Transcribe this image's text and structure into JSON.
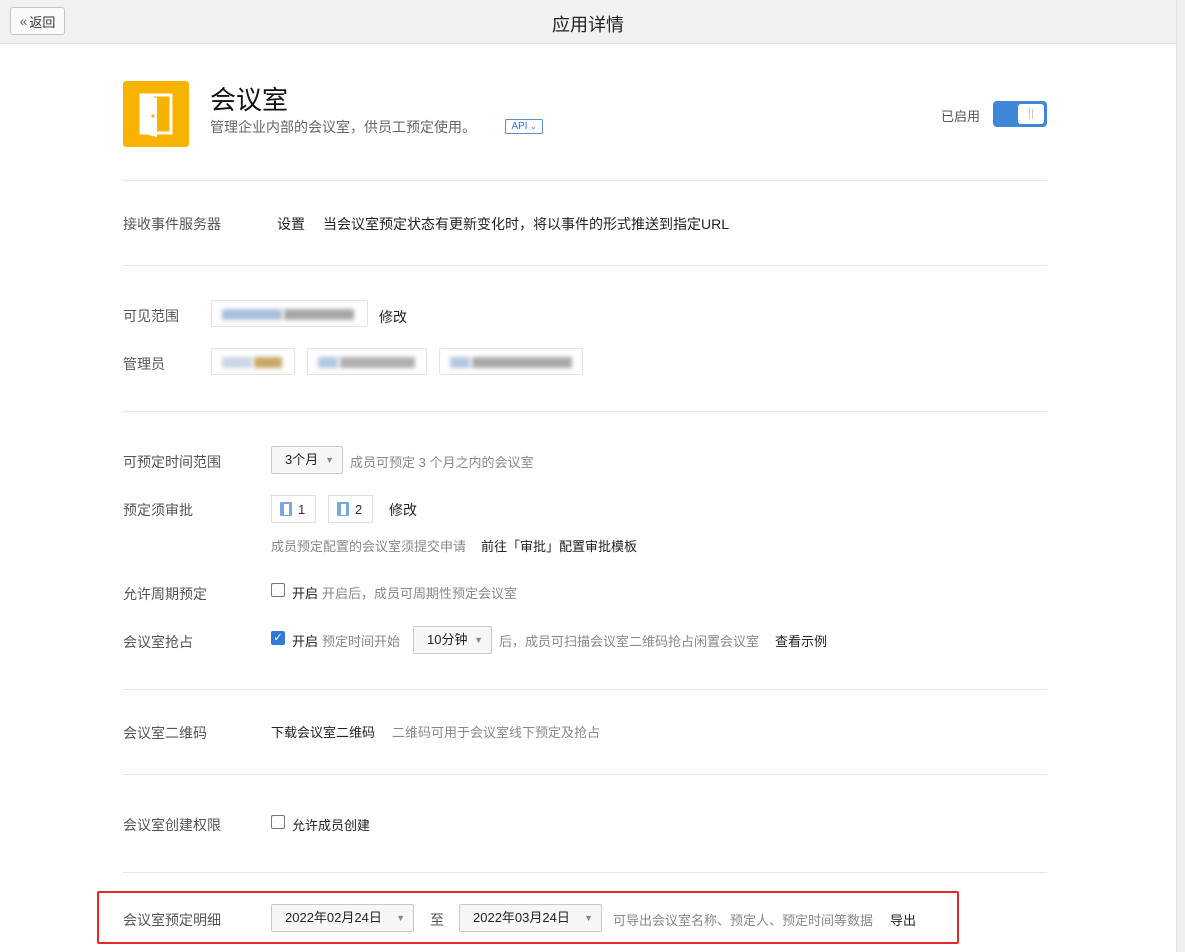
{
  "header": {
    "back_label": "返回",
    "title": "应用详情"
  },
  "app": {
    "name": "会议室",
    "description": "管理企业内部的会议室，供员工预定使用。",
    "api_tag": "API",
    "enabled_label": "已启用",
    "enabled": true,
    "icon_color": "#f8b300"
  },
  "event_server": {
    "label": "接收事件服务器",
    "link": "设置",
    "description": "当会议室预定状态有更新变化时，将以事件的形式推送到指定URL"
  },
  "visibility": {
    "label": "可见范围",
    "edit_link": "修改"
  },
  "admins": {
    "label": "管理员"
  },
  "booking_range": {
    "label": "可预定时间范围",
    "value": "3个月",
    "hint": "成员可预定 3 个月之内的会议室"
  },
  "approval": {
    "label": "预定须审批",
    "approvers": [
      "1",
      "2"
    ],
    "edit_link": "修改",
    "hint": "成员预定配置的会议室须提交申请",
    "template_link": "前往「审批」配置审批模板"
  },
  "recurring": {
    "label": "允许周期预定",
    "checked": false,
    "option": "开启",
    "hint": "开启后，成员可周期性预定会议室"
  },
  "grab": {
    "label": "会议室抢占",
    "checked": true,
    "option": "开启",
    "hint_before": "预定时间开始",
    "value": "10分钟",
    "hint_after": "后，成员可扫描会议室二维码抢占闲置会议室",
    "example_link": "查看示例"
  },
  "qrcode": {
    "label": "会议室二维码",
    "link": "下载会议室二维码",
    "hint": "二维码可用于会议室线下预定及抢占"
  },
  "create_permission": {
    "label": "会议室创建权限",
    "checked": false,
    "option": "允许成员创建"
  },
  "booking_details": {
    "label": "会议室预定明细",
    "start_date": "2022年02月24日",
    "to": "至",
    "end_date": "2022年03月24日",
    "hint": "可导出会议室名称、预定人、预定时间等数据",
    "export_link": "导出"
  }
}
